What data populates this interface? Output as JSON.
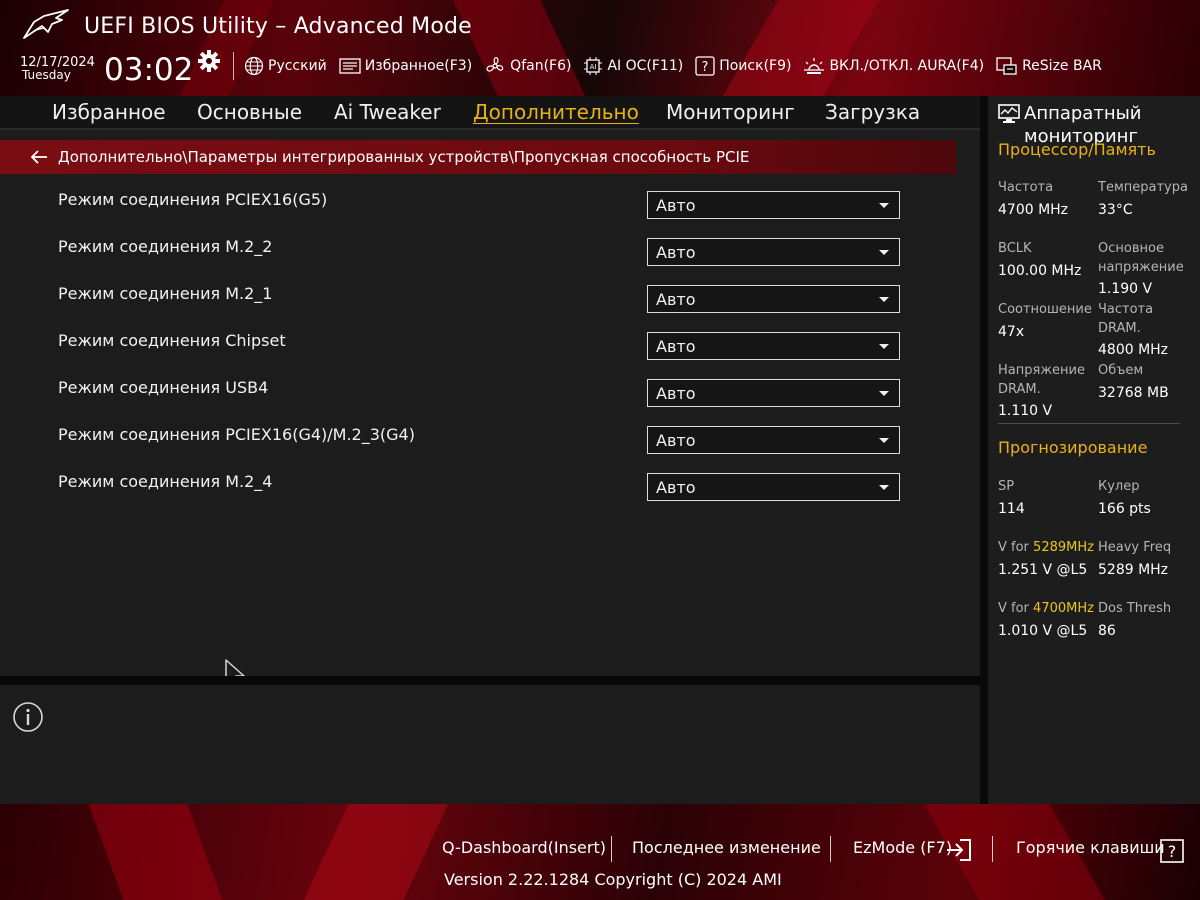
{
  "header": {
    "title": "UEFI BIOS Utility – Advanced Mode",
    "date": "12/17/2024",
    "day": "Tuesday",
    "time": "03:02"
  },
  "toolbar": {
    "language": "Русский",
    "favorites": "Избранное(F3)",
    "qfan": "Qfan(F6)",
    "ai_oc": "AI OC(F11)",
    "search": "Поиск(F9)",
    "aura": "ВКЛ./ОТКЛ. AURA(F4)",
    "resize_bar": "ReSize BAR"
  },
  "tabs": [
    {
      "label": "Избранное",
      "active": false
    },
    {
      "label": "Основные",
      "active": false
    },
    {
      "label": "Ai Tweaker",
      "active": false
    },
    {
      "label": "Дополнительно",
      "active": true
    },
    {
      "label": "Мониторинг",
      "active": false
    },
    {
      "label": "Загрузка",
      "active": false
    }
  ],
  "breadcrumb": "Дополнительно\\Параметры интегрированных устройств\\Пропускная способность PCIE",
  "settings": [
    {
      "label": "Режим соединения PCIEX16(G5)",
      "value": "Авто"
    },
    {
      "label": "Режим соединения M.2_2",
      "value": "Авто"
    },
    {
      "label": "Режим соединения M.2_1",
      "value": "Авто"
    },
    {
      "label": "Режим соединения Chipset",
      "value": "Авто"
    },
    {
      "label": "Режим соединения USB4",
      "value": "Авто"
    },
    {
      "label": "Режим соединения PCIEX16(G4)/M.2_3(G4)",
      "value": "Авто"
    },
    {
      "label": "Режим соединения M.2_4",
      "value": "Авто"
    }
  ],
  "hw_monitor": {
    "title": "Аппаратный\nмониторинг",
    "cpu_section": "Процессор/Память",
    "freq_label": "Частота",
    "freq_value": "4700 MHz",
    "temp_label": "Температура",
    "temp_value": "33°C",
    "bclk_label": "BCLK",
    "bclk_value": "100.00 MHz",
    "core_v_label": "Основное\nнапряжение",
    "core_v_value": "1.190 V",
    "ratio_label": "Соотношение",
    "ratio_value": "47x",
    "dram_freq_label": "Частота\nDRAM.",
    "dram_freq_value": "4800 MHz",
    "dram_v_label": "Напряжение\nDRAM.",
    "dram_v_value": "1.110 V",
    "capacity_label": "Объем",
    "capacity_value": "32768 MB",
    "predict_section": "Прогнозирование",
    "sp_label": "SP",
    "sp_value": "114",
    "cooler_label": "Кулер",
    "cooler_value": "166 pts",
    "vfor1_prefix": "V for ",
    "vfor1_freq": "5289MHz",
    "vfor1_value": "1.251 V @L5",
    "heavy_label": "Heavy Freq",
    "heavy_value": "5289 MHz",
    "vfor2_prefix": "V for ",
    "vfor2_freq": "4700MHz",
    "vfor2_value": "1.010 V @L5",
    "dos_label": "Dos Thresh",
    "dos_value": "86"
  },
  "footer": {
    "qdashboard": "Q-Dashboard(Insert)",
    "last_change": "Последнее изменение",
    "ezmode": "EzMode (F7)",
    "hotkeys": "Горячие клавиши",
    "hotkeys_icon_glyph": "?",
    "version": "Version 2.22.1284 Copyright (C) 2024 AMI"
  },
  "colors": {
    "accent": "#e8b215",
    "breadcrumb": "#7a0d12"
  },
  "icons": [
    "rog-logo-icon",
    "gear-icon",
    "globe-icon",
    "favorites-icon",
    "fan-icon",
    "ai-oc-icon",
    "search-help-icon",
    "aura-icon",
    "resize-bar-icon",
    "back-arrow-icon",
    "monitor-icon",
    "info-icon",
    "exit-icon",
    "help-icon",
    "mouse-cursor-icon"
  ]
}
